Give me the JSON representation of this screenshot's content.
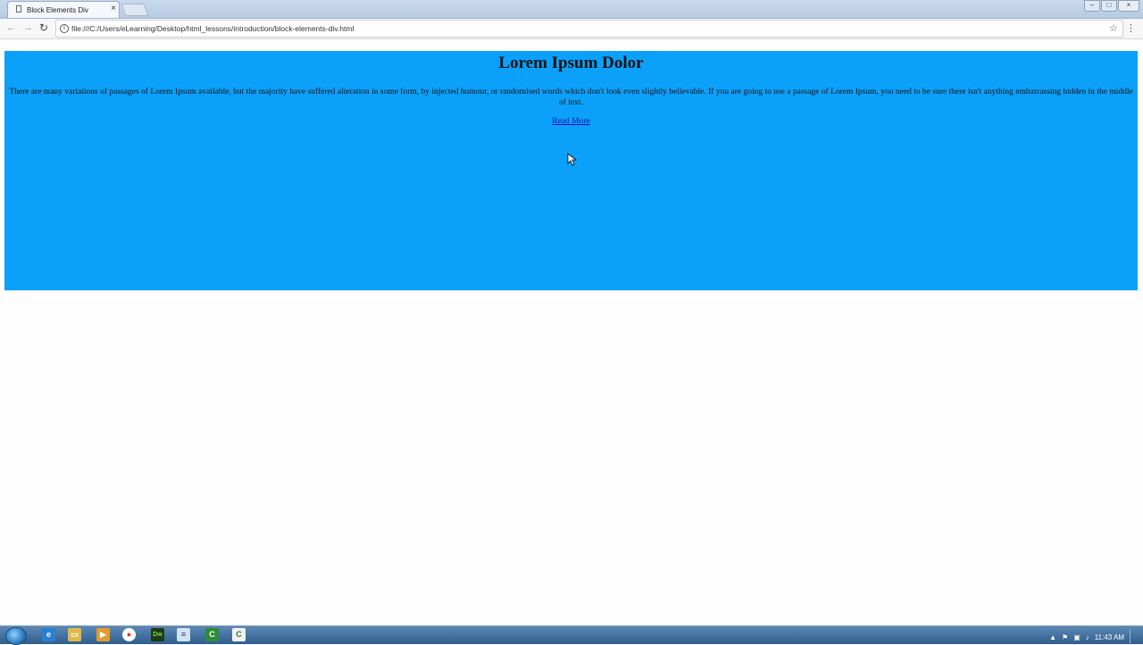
{
  "browser": {
    "tab_title": "Block Elements Div",
    "url": "file:///C:/Users/eLearning/Desktop/html_lessons/introduction/block-elements-div.html"
  },
  "page": {
    "heading": "Lorem Ipsum Dolor",
    "paragraph": "There are many variations of passages of Lorem Ipsum available, but the majority have suffered alteration in some form, by injected humour, or randomised words which don't look even slightly believable. If you are going to use a passage of Lorem Ipsum, you need to be sure there isn't anything embarrassing hidden in the middle of text.",
    "link": "Read More",
    "div_color": "#0ba1fb"
  },
  "taskbar": {
    "icons": [
      "internet-explorer-icon",
      "file-explorer-icon",
      "media-player-icon",
      "chrome-icon",
      "dreamweaver-icon",
      "notepad-icon",
      "camtasia-recorder-icon",
      "camtasia-studio-icon"
    ],
    "clock": "11:43 AM"
  }
}
